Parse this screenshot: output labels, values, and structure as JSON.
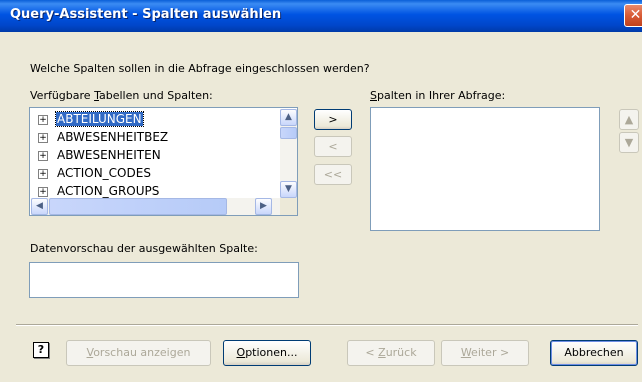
{
  "window": {
    "title": "Query-Assistent - Spalten auswählen",
    "close_glyph": "✕"
  },
  "prompt": "Welche Spalten sollen in die Abfrage eingeschlossen werden?",
  "available": {
    "label_pre": "Verfügbare ",
    "label_key": "T",
    "label_post": "abellen und Spalten:",
    "items": [
      {
        "label": "ABTEILUNGEN",
        "selected": true
      },
      {
        "label": "ABWESENHEITBEZ",
        "selected": false
      },
      {
        "label": "ABWESENHEITEN",
        "selected": false
      },
      {
        "label": "ACTION_CODES",
        "selected": false
      },
      {
        "label": "ACTION_GROUPS",
        "selected": false
      }
    ]
  },
  "move_buttons": {
    "add": ">",
    "remove": "<",
    "remove_all": "<<"
  },
  "query_columns": {
    "label_key": "S",
    "label_post": "palten in Ihrer Abfrage:"
  },
  "preview": {
    "label": "Datenvorschau der ausgewählten Spalte:",
    "value": ""
  },
  "footer": {
    "help": "?",
    "preview_key": "V",
    "preview_post": "orschau anzeigen",
    "options_key": "O",
    "options_post": "ptionen...",
    "back_pre": "< ",
    "back_key": "Z",
    "back_post": "urück",
    "next_key": "W",
    "next_post": "eiter >",
    "cancel": "Abbrechen"
  },
  "colors": {
    "title_bar": "#0054e3",
    "dialog_bg": "#ece9d8",
    "selection": "#316ac5",
    "close_button": "#d85b35"
  }
}
